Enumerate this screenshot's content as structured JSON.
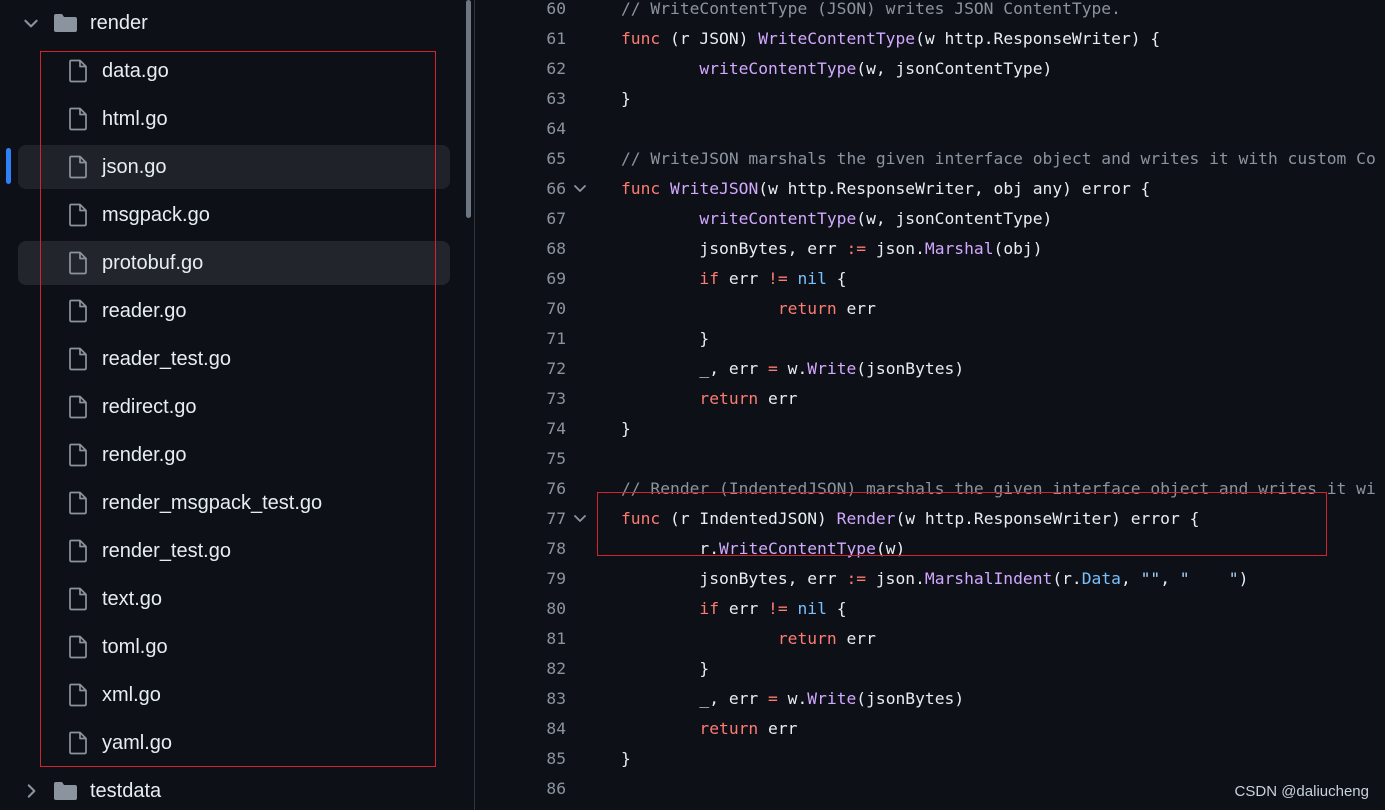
{
  "sidebar": {
    "folder": {
      "name": "render",
      "icon": "folder-icon",
      "expanded": true
    },
    "files": [
      {
        "name": "data.go"
      },
      {
        "name": "html.go"
      },
      {
        "name": "json.go"
      },
      {
        "name": "msgpack.go"
      },
      {
        "name": "protobuf.go"
      },
      {
        "name": "reader.go"
      },
      {
        "name": "reader_test.go"
      },
      {
        "name": "redirect.go"
      },
      {
        "name": "render.go"
      },
      {
        "name": "render_msgpack_test.go"
      },
      {
        "name": "render_test.go"
      },
      {
        "name": "text.go"
      },
      {
        "name": "toml.go"
      },
      {
        "name": "xml.go"
      },
      {
        "name": "yaml.go"
      }
    ],
    "selected_file": "json.go",
    "hovered_file": "protobuf.go",
    "next_folder": {
      "name": "testdata",
      "icon": "folder-icon",
      "expanded": false
    }
  },
  "colors": {
    "background": "#0d1117",
    "keyword": "#ff7b72",
    "function": "#d2a8ff",
    "comment": "#8b949e",
    "constant": "#79c0ff",
    "string": "#a5d6ff",
    "highlight_box": "#d1242f",
    "active_marker": "#2f81f7"
  },
  "code": {
    "lines": [
      {
        "n": "60",
        "fold": false,
        "tokens": [
          [
            "com",
            "// WriteContentType (JSON) writes JSON ContentType."
          ]
        ]
      },
      {
        "n": "61",
        "fold": false,
        "tokens": [
          [
            "kw",
            "func"
          ],
          [
            "id",
            " (r JSON) "
          ],
          [
            "fn",
            "WriteContentType"
          ],
          [
            "id",
            "(w http.ResponseWriter) {"
          ]
        ]
      },
      {
        "n": "62",
        "fold": false,
        "tokens": [
          [
            "id",
            "        "
          ],
          [
            "fn",
            "writeContentType"
          ],
          [
            "id",
            "(w, jsonContentType)"
          ]
        ]
      },
      {
        "n": "63",
        "fold": false,
        "tokens": [
          [
            "id",
            "}"
          ]
        ]
      },
      {
        "n": "64",
        "fold": false,
        "tokens": []
      },
      {
        "n": "65",
        "fold": false,
        "tokens": [
          [
            "com",
            "// WriteJSON marshals the given interface object and writes it with custom Co"
          ]
        ]
      },
      {
        "n": "66",
        "fold": true,
        "tokens": [
          [
            "kw",
            "func"
          ],
          [
            "id",
            " "
          ],
          [
            "fn",
            "WriteJSON"
          ],
          [
            "id",
            "(w http.ResponseWriter, obj any) error {"
          ]
        ]
      },
      {
        "n": "67",
        "fold": false,
        "tokens": [
          [
            "id",
            "        "
          ],
          [
            "fn",
            "writeContentType"
          ],
          [
            "id",
            "(w, jsonContentType)"
          ]
        ]
      },
      {
        "n": "68",
        "fold": false,
        "tokens": [
          [
            "id",
            "        jsonBytes, err "
          ],
          [
            "kw",
            ":="
          ],
          [
            "id",
            " json."
          ],
          [
            "fn",
            "Marshal"
          ],
          [
            "id",
            "(obj)"
          ]
        ]
      },
      {
        "n": "69",
        "fold": false,
        "tokens": [
          [
            "id",
            "        "
          ],
          [
            "kw",
            "if"
          ],
          [
            "id",
            " err "
          ],
          [
            "kw",
            "!="
          ],
          [
            "id",
            " "
          ],
          [
            "con",
            "nil"
          ],
          [
            "id",
            " {"
          ]
        ]
      },
      {
        "n": "70",
        "fold": false,
        "tokens": [
          [
            "id",
            "                "
          ],
          [
            "kw",
            "return"
          ],
          [
            "id",
            " err"
          ]
        ]
      },
      {
        "n": "71",
        "fold": false,
        "tokens": [
          [
            "id",
            "        }"
          ]
        ]
      },
      {
        "n": "72",
        "fold": false,
        "tokens": [
          [
            "id",
            "        _, err "
          ],
          [
            "kw",
            "="
          ],
          [
            "id",
            " w."
          ],
          [
            "fn",
            "Write"
          ],
          [
            "id",
            "(jsonBytes)"
          ]
        ]
      },
      {
        "n": "73",
        "fold": false,
        "tokens": [
          [
            "id",
            "        "
          ],
          [
            "kw",
            "return"
          ],
          [
            "id",
            " err"
          ]
        ]
      },
      {
        "n": "74",
        "fold": false,
        "tokens": [
          [
            "id",
            "}"
          ]
        ]
      },
      {
        "n": "75",
        "fold": false,
        "tokens": []
      },
      {
        "n": "76",
        "fold": false,
        "tokens": [
          [
            "com",
            "// Render (IndentedJSON) marshals the given interface object and writes it wi"
          ]
        ]
      },
      {
        "n": "77",
        "fold": true,
        "tokens": [
          [
            "kw",
            "func"
          ],
          [
            "id",
            " (r IndentedJSON) "
          ],
          [
            "fn",
            "Render"
          ],
          [
            "id",
            "(w http.ResponseWriter) error {"
          ]
        ]
      },
      {
        "n": "78",
        "fold": false,
        "tokens": [
          [
            "id",
            "        r."
          ],
          [
            "fn",
            "WriteContentType"
          ],
          [
            "id",
            "(w)"
          ]
        ]
      },
      {
        "n": "79",
        "fold": false,
        "tokens": [
          [
            "id",
            "        jsonBytes, err "
          ],
          [
            "kw",
            ":="
          ],
          [
            "id",
            " json."
          ],
          [
            "fn",
            "MarshalIndent"
          ],
          [
            "id",
            "(r."
          ],
          [
            "con",
            "Data"
          ],
          [
            "id",
            ", "
          ],
          [
            "str",
            "\"\""
          ],
          [
            "id",
            ", "
          ],
          [
            "str",
            "\"    \""
          ],
          [
            "id",
            ")"
          ]
        ]
      },
      {
        "n": "80",
        "fold": false,
        "tokens": [
          [
            "id",
            "        "
          ],
          [
            "kw",
            "if"
          ],
          [
            "id",
            " err "
          ],
          [
            "kw",
            "!="
          ],
          [
            "id",
            " "
          ],
          [
            "con",
            "nil"
          ],
          [
            "id",
            " {"
          ]
        ]
      },
      {
        "n": "81",
        "fold": false,
        "tokens": [
          [
            "id",
            "                "
          ],
          [
            "kw",
            "return"
          ],
          [
            "id",
            " err"
          ]
        ]
      },
      {
        "n": "82",
        "fold": false,
        "tokens": [
          [
            "id",
            "        }"
          ]
        ]
      },
      {
        "n": "83",
        "fold": false,
        "tokens": [
          [
            "id",
            "        _, err "
          ],
          [
            "kw",
            "="
          ],
          [
            "id",
            " w."
          ],
          [
            "fn",
            "Write"
          ],
          [
            "id",
            "(jsonBytes)"
          ]
        ]
      },
      {
        "n": "84",
        "fold": false,
        "tokens": [
          [
            "id",
            "        "
          ],
          [
            "kw",
            "return"
          ],
          [
            "id",
            " err"
          ]
        ]
      },
      {
        "n": "85",
        "fold": false,
        "tokens": [
          [
            "id",
            "}"
          ]
        ]
      },
      {
        "n": "86",
        "fold": false,
        "tokens": []
      }
    ]
  },
  "watermark": "CSDN @daliucheng"
}
